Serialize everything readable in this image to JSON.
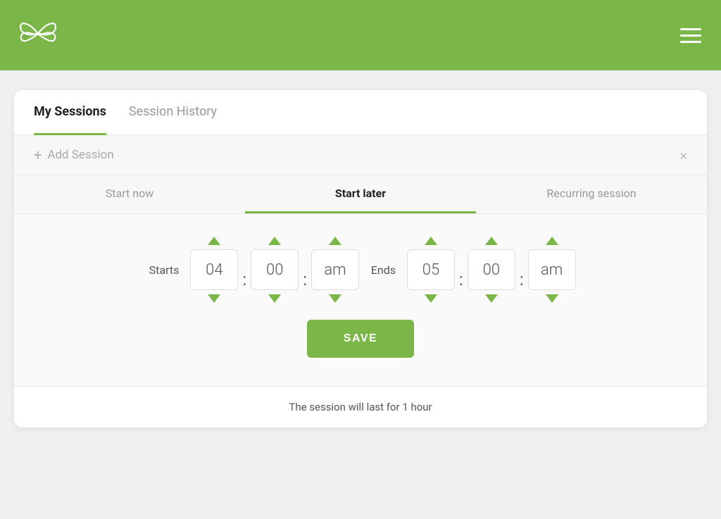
{
  "header": {
    "logo_alt": "Butterfly logo",
    "menu_icon_alt": "Menu"
  },
  "tabs": {
    "my_sessions": "My Sessions",
    "session_history": "Session History"
  },
  "active_tab": "my_sessions",
  "add_session": {
    "label": "Add Session",
    "close_icon": "×"
  },
  "sub_tabs": {
    "start_now": "Start now",
    "start_later": "Start later",
    "recurring": "Recurring session"
  },
  "active_sub_tab": "start_later",
  "time_picker": {
    "starts_label": "Starts",
    "ends_label": "Ends",
    "start_hour": "04",
    "start_minute": "00",
    "start_period": "am",
    "end_hour": "05",
    "end_minute": "00",
    "end_period": "am"
  },
  "save_button": "SAVE",
  "session_info": "The session will last for 1 hour"
}
